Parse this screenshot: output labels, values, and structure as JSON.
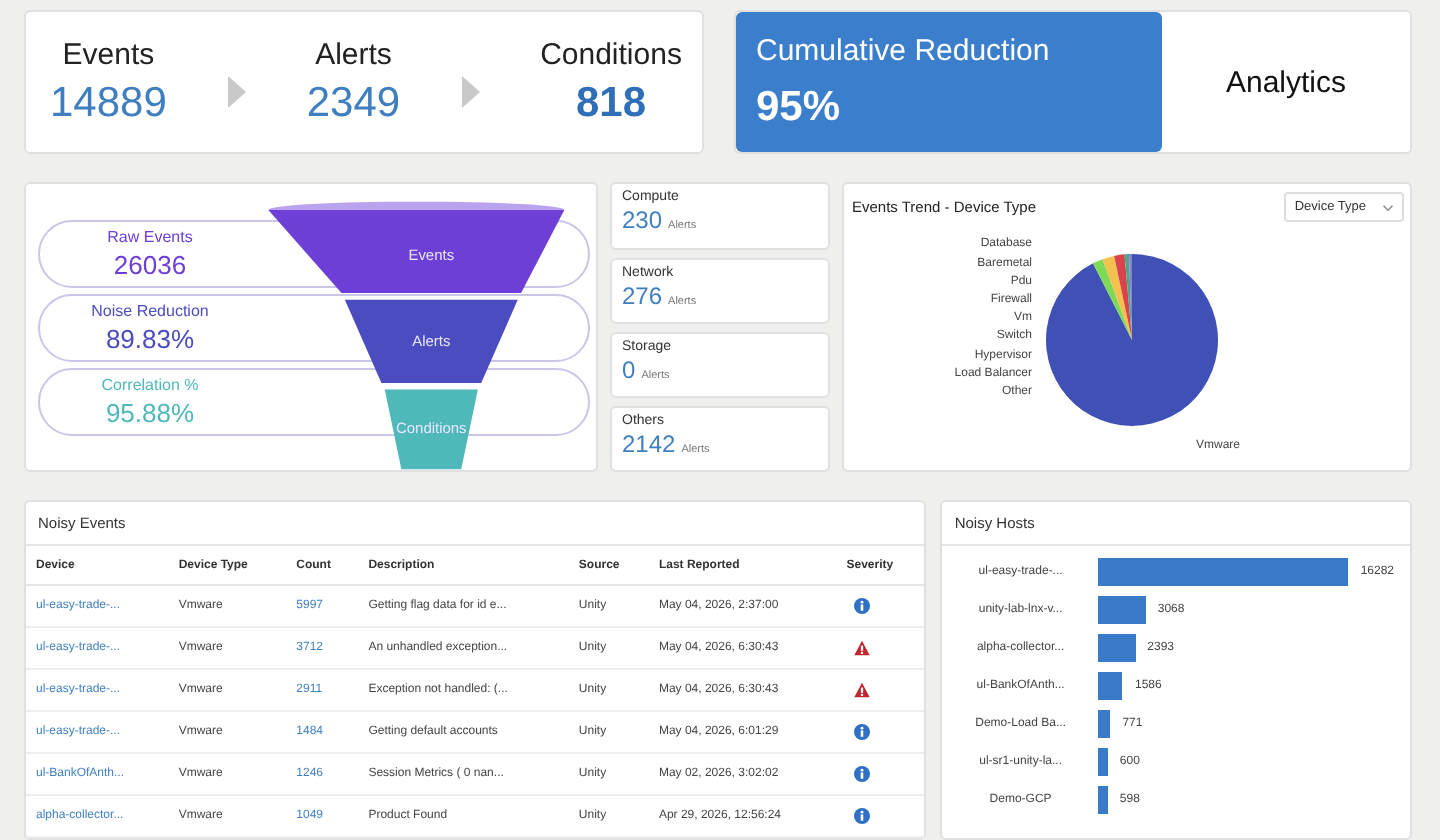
{
  "summary": {
    "stages": [
      {
        "label": "Events",
        "value": "14889",
        "emphasis": false
      },
      {
        "label": "Alerts",
        "value": "2349",
        "emphasis": false
      },
      {
        "label": "Conditions",
        "value": "818",
        "emphasis": true
      }
    ],
    "reduction": {
      "label": "Cumulative Reduction",
      "value": "95%"
    },
    "analytics": {
      "label": "Analytics"
    }
  },
  "funnel": [
    {
      "label": "Raw Events",
      "value": "26036",
      "stage": "Events",
      "color": "#6e3fd6"
    },
    {
      "label": "Noise Reduction",
      "value": "89.83%",
      "stage": "Alerts",
      "color": "#4b4cc0"
    },
    {
      "label": "Correlation %",
      "value": "95.88%",
      "stage": "Conditions",
      "color": "#4fb8b8"
    }
  ],
  "alert_groups": [
    {
      "name": "Compute",
      "count": "230",
      "unit": "Alerts"
    },
    {
      "name": "Network",
      "count": "276",
      "unit": "Alerts"
    },
    {
      "name": "Storage",
      "count": "0",
      "unit": "Alerts"
    },
    {
      "name": "Others",
      "count": "2142",
      "unit": "Alerts"
    }
  ],
  "events_trend": {
    "title": "Events Trend - Device Type",
    "dropdown": "Device Type",
    "labels_left": [
      "Database",
      "Baremetal",
      "Pdu",
      "Firewall",
      "Vm",
      "Switch",
      "Hypervisor",
      "Load Balancer",
      "Other"
    ],
    "label_bottom": "Vmware"
  },
  "noisy_events": {
    "title": "Noisy Events",
    "columns": [
      "Device",
      "Device Type",
      "Count",
      "Description",
      "Source",
      "Last Reported",
      "Severity"
    ],
    "rows": [
      {
        "device": "ul-easy-trade-...",
        "device_type": "Vmware",
        "count": "5997",
        "description": "Getting flag data for id e...",
        "source": "Unity",
        "last_reported": "May 04, 2026, 2:37:00",
        "critical": false
      },
      {
        "device": "ul-easy-trade-...",
        "device_type": "Vmware",
        "count": "3712",
        "description": "An unhandled exception...",
        "source": "Unity",
        "last_reported": "May 04, 2026, 6:30:43",
        "critical": true
      },
      {
        "device": "ul-easy-trade-...",
        "device_type": "Vmware",
        "count": "2911",
        "description": "Exception not handled: (...",
        "source": "Unity",
        "last_reported": "May 04, 2026, 6:30:43",
        "critical": true
      },
      {
        "device": "ul-easy-trade-...",
        "device_type": "Vmware",
        "count": "1484",
        "description": "Getting default accounts",
        "source": "Unity",
        "last_reported": "May 04, 2026, 6:01:29",
        "critical": false
      },
      {
        "device": "ul-BankOfAnth...",
        "device_type": "Vmware",
        "count": "1246",
        "description": "Session Metrics ( 0 nan...",
        "source": "Unity",
        "last_reported": "May 02, 2026, 3:02:02",
        "critical": false
      },
      {
        "device": "alpha-collector...",
        "device_type": "Vmware",
        "count": "1049",
        "description": "Product Found",
        "source": "Unity",
        "last_reported": "Apr 29, 2026, 12:56:24",
        "critical": false
      }
    ]
  },
  "noisy_hosts": {
    "title": "Noisy Hosts",
    "chart_data": {
      "type": "bar",
      "orientation": "horizontal",
      "data_labels": true,
      "categories": [
        "ul-easy-trade-...",
        "unity-lab-lnx-v...",
        "alpha-collector...",
        "ul-BankOfAnth...",
        "Demo-Load Ba...",
        "ul-sr1-unity-la...",
        "Demo-GCP"
      ],
      "values": [
        16282,
        3068,
        2393,
        1586,
        771,
        600,
        598
      ]
    }
  }
}
